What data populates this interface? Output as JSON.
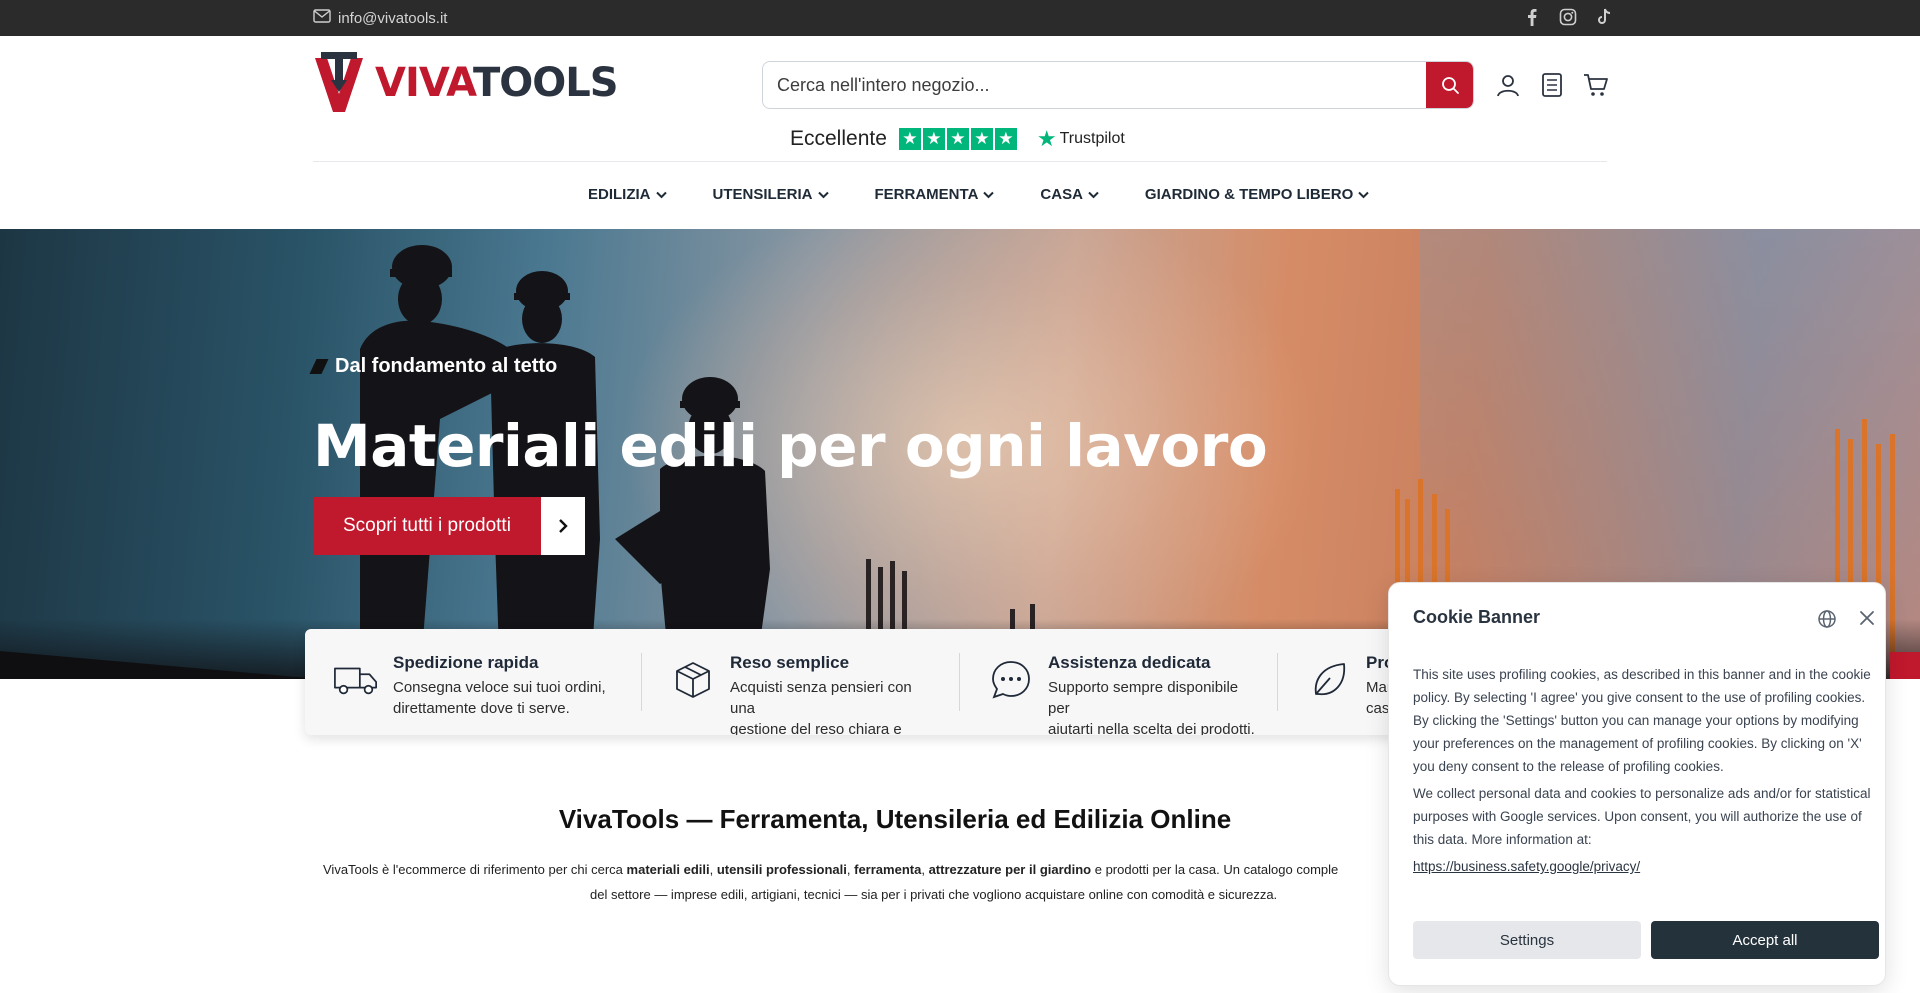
{
  "topbar": {
    "email": "info@vivatools.it",
    "social_icons": [
      "facebook-icon",
      "instagram-icon",
      "tiktok-icon"
    ]
  },
  "header": {
    "logo": {
      "part1": "VIVA",
      "part2": "TOOLS"
    },
    "search": {
      "placeholder": "Cerca nell'intero negozio...",
      "value": ""
    },
    "icons": [
      "user-icon",
      "list-icon",
      "cart-icon"
    ]
  },
  "trustpilot": {
    "rating_label": "Eccellente",
    "stars": 5,
    "brand": "Trustpilot"
  },
  "nav": {
    "items": [
      {
        "label": "EDILIZIA"
      },
      {
        "label": "UTENSILERIA"
      },
      {
        "label": "FERRAMENTA"
      },
      {
        "label": "CASA"
      },
      {
        "label": "GIARDINO & TEMPO LIBERO"
      }
    ]
  },
  "hero": {
    "tagline": "Dal fondamento al tetto",
    "title": "Materiali edili per ogni lavoro",
    "cta_label": "Scopri tutti i prodotti"
  },
  "features": [
    {
      "icon": "truck-icon",
      "title": "Spedizione rapida",
      "line1": "Consegna veloce sui tuoi ordini,",
      "line2": "direttamente dove ti serve."
    },
    {
      "icon": "box-icon",
      "title": "Reso semplice",
      "line1": "Acquisti senza pensieri con una",
      "line2": "gestione del reso chiara e veloce."
    },
    {
      "icon": "chat-icon",
      "title": "Assistenza dedicata",
      "line1": "Supporto sempre disponibile per",
      "line2": "aiutarti nella scelta dei prodotti."
    },
    {
      "icon": "leaf-icon",
      "title": "Prodo",
      "line1": "Marchi",
      "line2": "casa, e"
    }
  ],
  "about": {
    "title": "VivaTools — Ferramenta, Utensileria ed Edilizia Online",
    "text_start": "VivaTools è l'ecommerce di riferimento per chi cerca ",
    "bold1": "materiali edili",
    "sep1": ", ",
    "bold2": "utensili professionali",
    "sep2": ", ",
    "bold3": "ferramenta",
    "sep3": ", ",
    "bold4": "attrezzature per il giardino",
    "text_mid": " e prodotti per la casa. Un catalogo comple",
    "text_line2": "del settore — imprese edili, artigiani, tecnici — sia per i privati che vogliono acquistare online con comodità e sicurezza."
  },
  "cookie_banner": {
    "title": "Cookie Banner",
    "paragraph1": "This site uses profiling cookies, as described in this banner and in the cookie policy. By selecting 'I agree' you give consent to the use of profiling cookies. By clicking the 'Settings' button you can manage your options by modifying your preferences on the management of profiling cookies. By clicking on 'X' you deny consent to the release of profiling cookies.",
    "paragraph2": "We collect personal data and cookies to personalize ads and/or for statistical purposes with Google services. Upon consent, you will authorize the use of this data. More information at:",
    "link": "https://business.safety.google/privacy/",
    "settings_label": "Settings",
    "accept_label": "Accept all"
  },
  "colors": {
    "brand_red": "#c0182c",
    "dark_navy": "#24323c",
    "trustpilot_green": "#00b67a",
    "topbar_bg": "#2b2b2b"
  }
}
